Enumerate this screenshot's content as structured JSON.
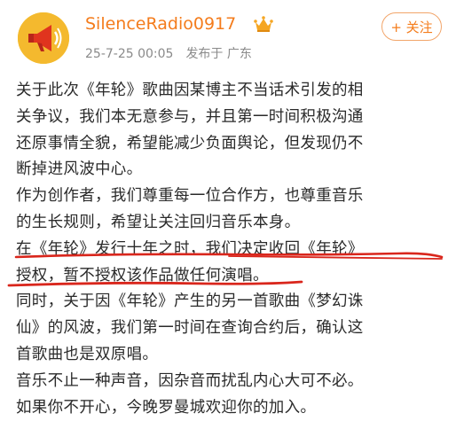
{
  "post": {
    "author": {
      "name": "SilenceRadio0917",
      "avatar_icon": "megaphone-icon",
      "badge_icon": "crown-badge-icon"
    },
    "timestamp": "25-7-25 00:05",
    "location": "发布于 广东",
    "follow_label": "+ 关注",
    "paragraphs": [
      {
        "lines": [
          "关于此次《年轮》歌曲因某博主不当话术引发的相",
          "关争议，我们本无意参与，并且第一时间积极沟通",
          "还原事情全貌，希望能减少负面舆论，但发现仍不",
          "断掉进风波中心。"
        ]
      },
      {
        "lines": [
          "作为创作者，我们尊重每一位合作方，也尊重音乐",
          "的生长规则，希望让关注回归音乐本身。"
        ]
      },
      {
        "lines": [
          "在《年轮》发行十年之时，我们决定收回《年轮》",
          "授权，暂不授权该作品做任何演唱。"
        ]
      },
      {
        "lines": [
          "同时，关于因《年轮》产生的另一首歌曲《梦幻诛",
          "仙》的风波，我们第一时间在查询合约后，确认这",
          "首歌曲也是双原唱。"
        ]
      },
      {
        "lines": [
          "音乐不止一种声音，因杂音而扰乱内心大可不必。"
        ]
      },
      {
        "lines": [
          "如果你不开心，今晚罗曼城欢迎你的加入。"
        ]
      }
    ]
  },
  "colors": {
    "username": "#f47c1c",
    "follow_border": "#f2a56a",
    "meta_text": "#8a8a8a",
    "annotation_red": "#d9261c"
  }
}
